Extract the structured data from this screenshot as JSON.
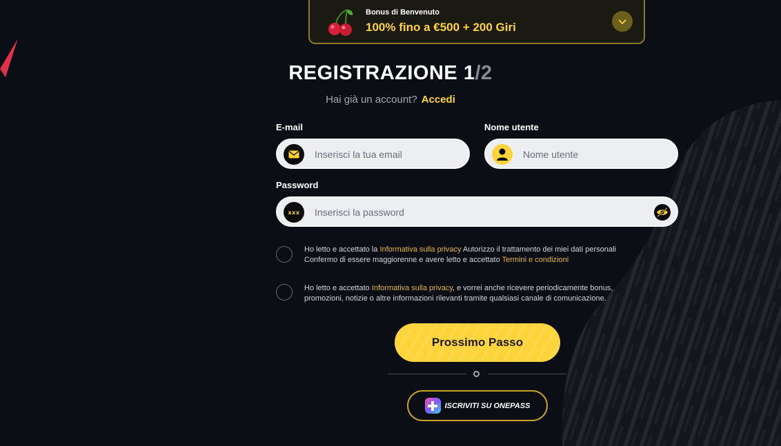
{
  "bonus": {
    "label": "Bonus di Benvenuto",
    "title": "100% fino a €500 + 200 Giri"
  },
  "page": {
    "title": "REGISTRAZIONE",
    "step_current": "1",
    "step_total": "/2",
    "subtitle": "Hai già un account?",
    "login_link": "Accedi"
  },
  "form": {
    "email_label": "E-mail",
    "email_placeholder": "Inserisci la tua email",
    "username_label": "Nome utente",
    "username_placeholder": "Nome utente",
    "password_label": "Password",
    "password_placeholder": "Inserisci la password",
    "password_icon_text": "xxx"
  },
  "consents": [
    {
      "text1": "Ho letto e accettato la ",
      "link1": "Informativa sulla privacy",
      "text2": " Autorizzo il trattamento dei miei dati personali",
      "text3": "Confermo di essere maggiorenne e avere letto e accettato ",
      "link2": "Termini e condizioni"
    },
    {
      "text1": "Ho letto e accettato ",
      "link1": "Informativa sulla privacy",
      "text2": ", e vorrei anche ricevere periodicamente bonus,",
      "text3": "promozioni, notizie o altre informazioni rilevanti tramite qualsiasi canale di comunicazione."
    }
  ],
  "actions": {
    "next_label": "Prossimo Passo",
    "divider_text": "o",
    "onepass_label": "ISCRIVITI SU ONEPASS"
  },
  "colors": {
    "background": "#0b0e14",
    "accent": "#ffd43a",
    "link": "#e8b730",
    "input_bg": "#eceef2"
  },
  "icons": [
    "cherry-icon",
    "chevron-down-icon",
    "envelope-icon",
    "user-icon",
    "password-icon",
    "eye-slash-icon",
    "onepass-icon"
  ]
}
